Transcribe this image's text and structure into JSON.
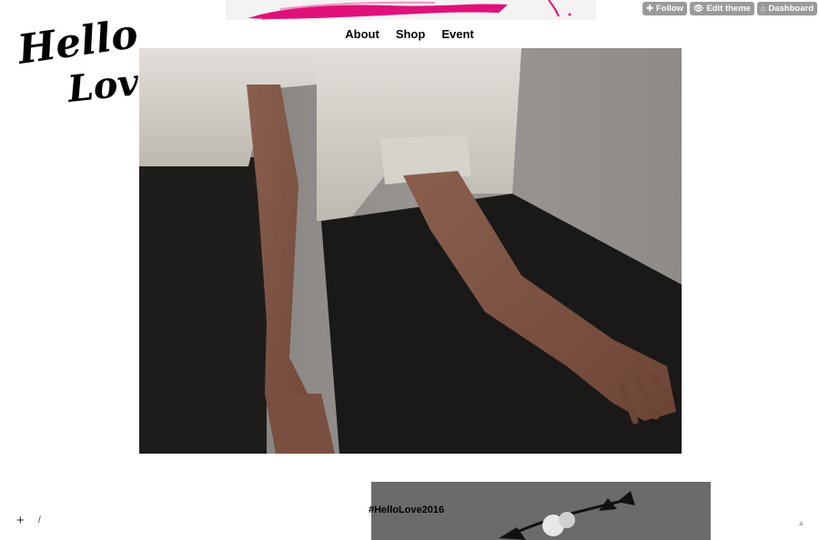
{
  "logo": {
    "line1": "Hello",
    "line2": "Love"
  },
  "nav": {
    "items": [
      "About",
      "Shop",
      "Event"
    ]
  },
  "controls": {
    "follow": "Follow",
    "edit_theme": "Edit theme",
    "dashboard": "Dashboard"
  },
  "posts": [
    {
      "type": "photo",
      "caption": ""
    },
    {
      "type": "photo",
      "caption": "#HelloLove2016"
    }
  ],
  "footer": {
    "plus": "+",
    "slash": "/",
    "to_top": "▲"
  },
  "colors": {
    "banner_pink": "#e0117a",
    "button_grey": "#9a9a9a"
  }
}
